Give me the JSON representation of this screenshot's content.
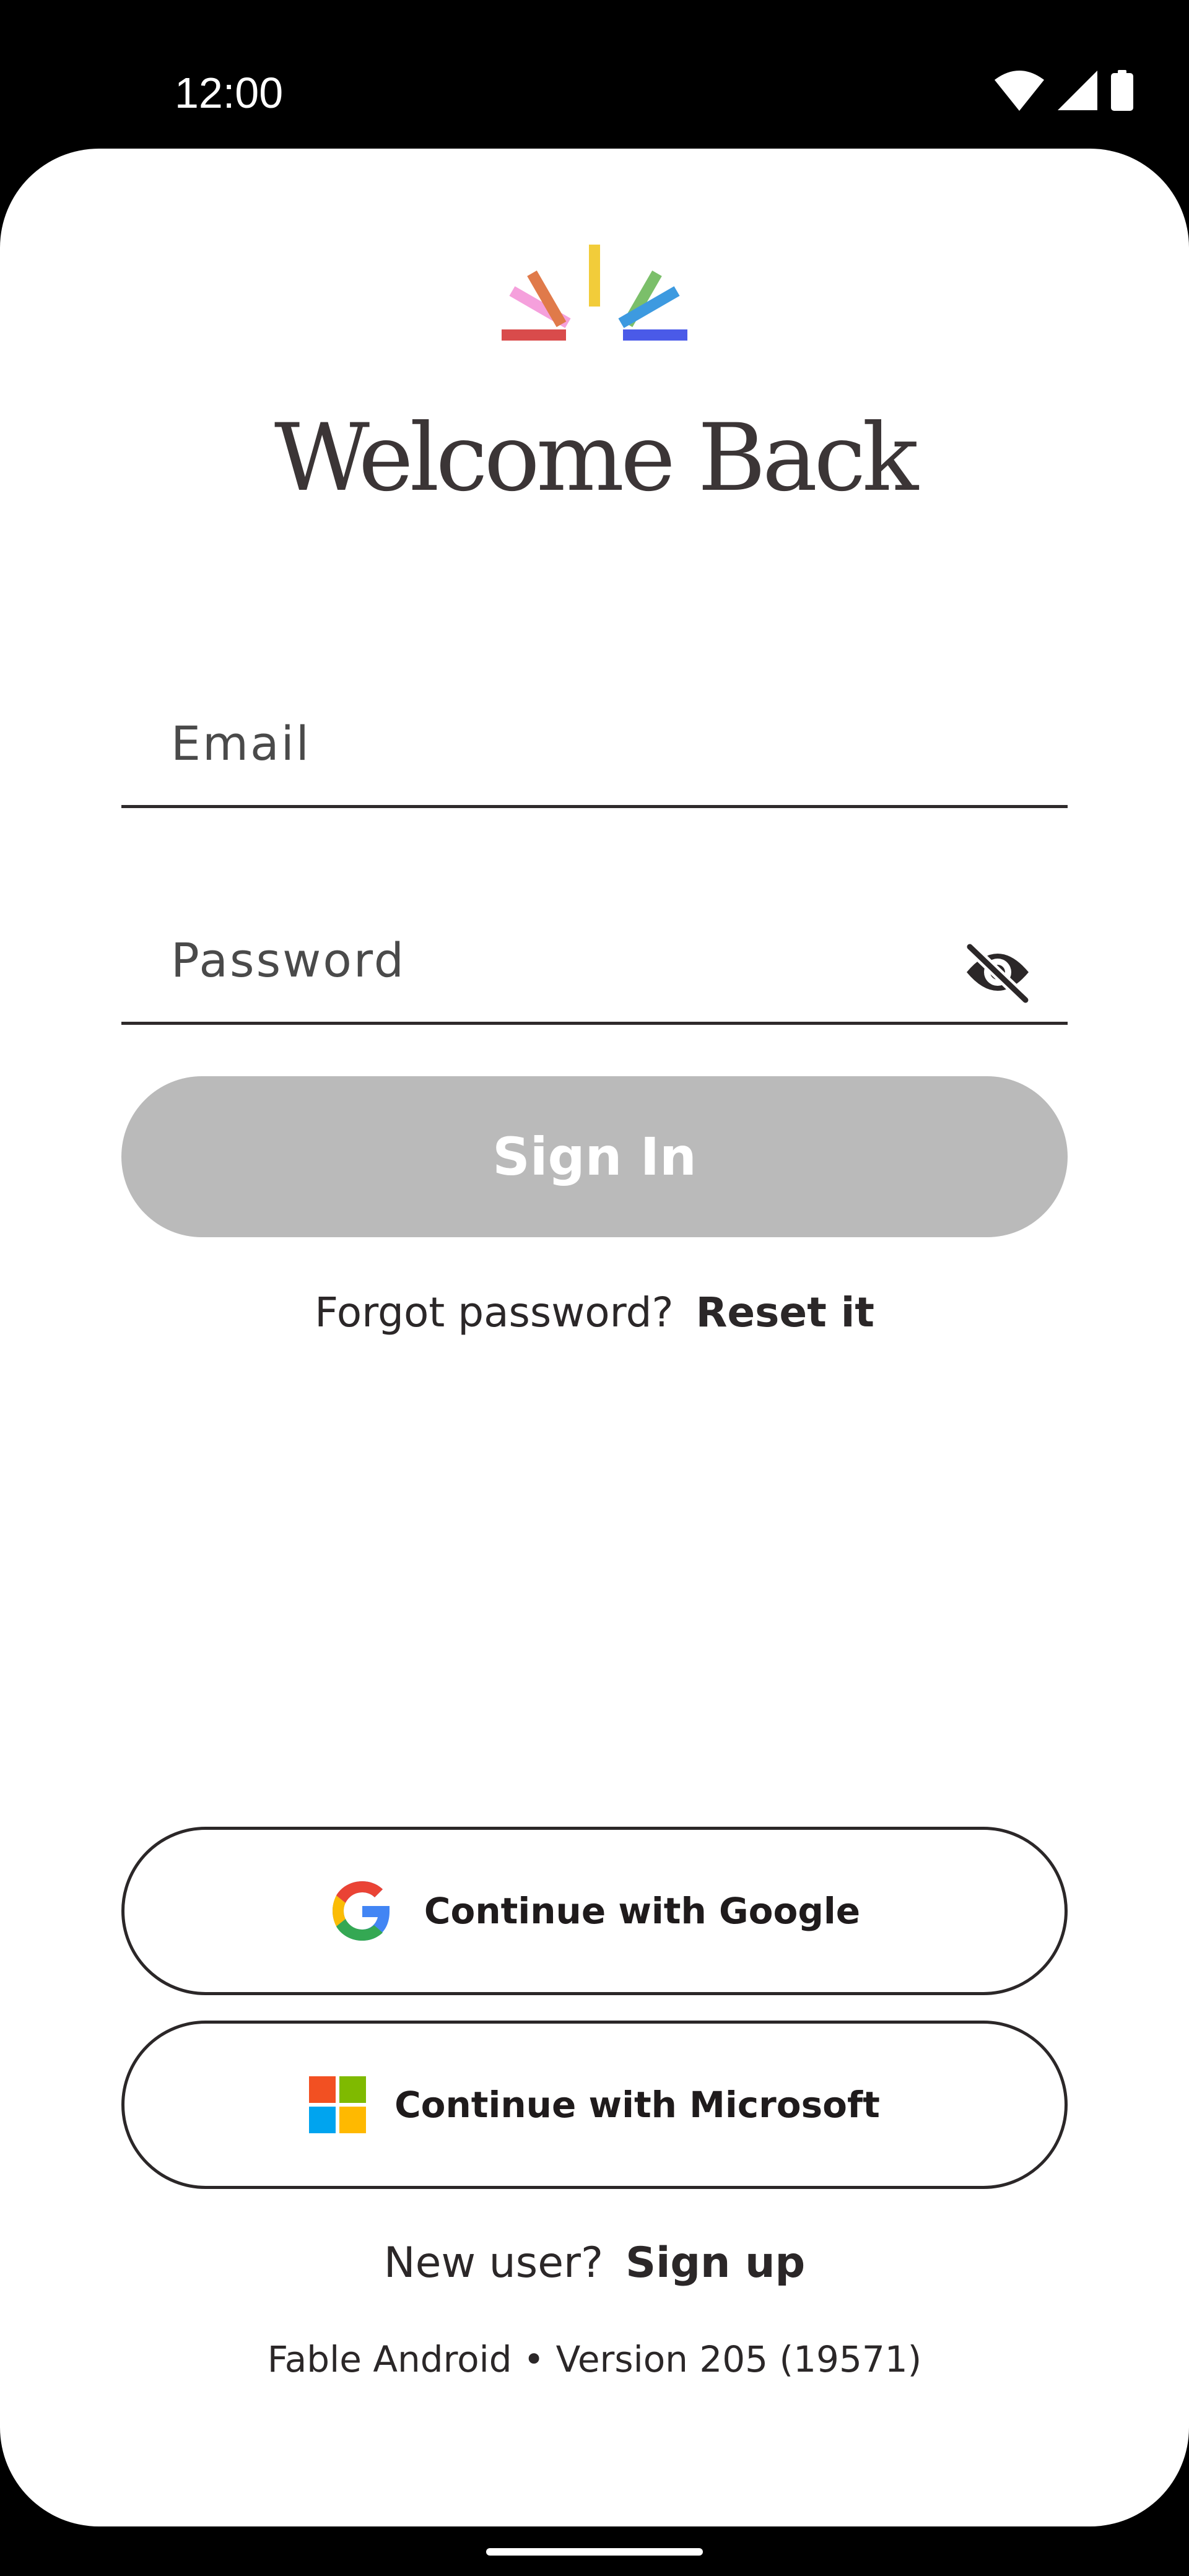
{
  "status_bar": {
    "time": "12:00",
    "icons": [
      "wifi-icon",
      "cellular-signal-icon",
      "battery-icon"
    ]
  },
  "logo": {
    "icon": "sunrise-logo-icon",
    "colors": [
      "#d94b4b",
      "#f5a0dc",
      "#e07a4a",
      "#f2cc3a",
      "#7bbf6a",
      "#3d9ae0",
      "#4a5ae8"
    ]
  },
  "title": "Welcome Back",
  "form": {
    "email_placeholder": "Email",
    "email_value": "",
    "password_placeholder": "Password",
    "password_value": "",
    "password_visibility_icon": "eye-off-icon",
    "sign_in_label": "Sign In",
    "sign_in_enabled": false
  },
  "forgot": {
    "prompt": "Forgot password?",
    "link": "Reset it"
  },
  "oauth": {
    "google_label": "Continue with Google",
    "microsoft_label": "Continue with Microsoft",
    "google_icon": "google-icon",
    "microsoft_icon": "microsoft-icon"
  },
  "signup": {
    "prompt": "New user?",
    "link": "Sign up"
  },
  "footer": {
    "version": "Fable Android • Version 205 (19571)"
  },
  "colors": {
    "text": "#2b2728",
    "disabled_button": "#bababa",
    "background": "#ffffff"
  }
}
